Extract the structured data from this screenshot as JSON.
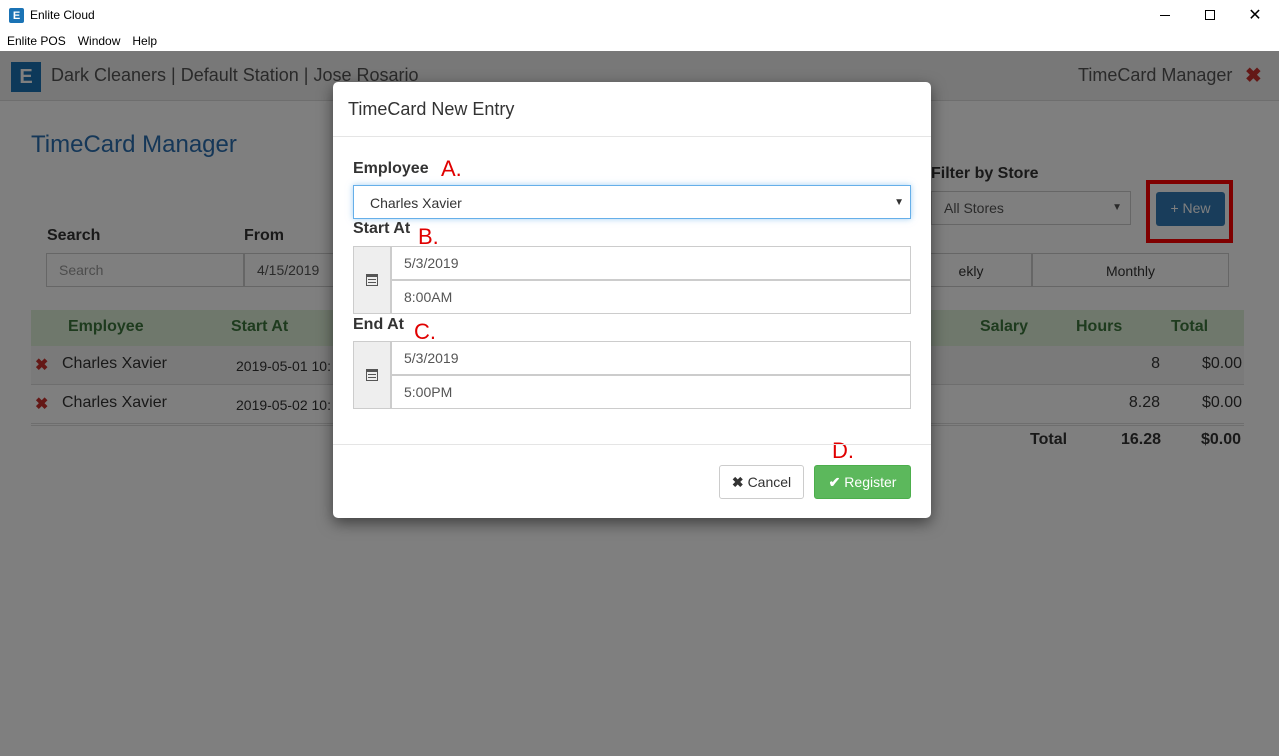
{
  "window": {
    "title": "Enlite Cloud",
    "icon_letter": "E",
    "minimize_icon": "minimize-icon",
    "maximize_icon": "maximize-icon",
    "close_glyph": "✕"
  },
  "menu": [
    "Enlite POS",
    "Window",
    "Help"
  ],
  "header": {
    "logo_letter": "E",
    "title": "Dark Cleaners | Default Station | Jose Rosario",
    "section": "TimeCard Manager",
    "close_glyph": "✖"
  },
  "page": {
    "title": "TimeCard Manager",
    "search_label": "Search",
    "search_placeholder": "Search",
    "from_label": "From",
    "from_value": "4/15/2019",
    "store_label": "Filter by Store",
    "store_value": "All Stores",
    "weekly_label": "ekly",
    "monthly_label": "Monthly",
    "new_button": "+ New"
  },
  "table": {
    "headers": {
      "employee": "Employee",
      "start_at": "Start At",
      "salary": "Salary",
      "hours": "Hours",
      "total": "Total"
    },
    "rows": [
      {
        "employee": "Charles Xavier",
        "start": "2019-05-01 10:",
        "hours": "8",
        "total": "$0.00"
      },
      {
        "employee": "Charles Xavier",
        "start": "2019-05-02 10:",
        "hours": "8.28",
        "total": "$0.00"
      }
    ],
    "totals": {
      "label": "Total",
      "hours": "16.28",
      "total": "$0.00"
    }
  },
  "modal": {
    "title": "TimeCard New Entry",
    "employee_label": "Employee",
    "employee_value": "Charles Xavier",
    "start_label": "Start At",
    "start_date": "5/3/2019",
    "start_time": "8:00AM",
    "end_label": "End At",
    "end_date": "5/3/2019",
    "end_time": "5:00PM",
    "cancel_label": "Cancel",
    "register_label": "Register"
  },
  "annotations": {
    "a": "A.",
    "b": "B.",
    "c": "C.",
    "d": "D."
  },
  "colors": {
    "brand": "#1a73b5",
    "primary_button": "#337ab7",
    "success_button": "#5cb85c",
    "highlight": "#ff0000",
    "annotation": "#e00000",
    "delete": "#c9302c",
    "table_header_bg": "#dff0d8"
  }
}
